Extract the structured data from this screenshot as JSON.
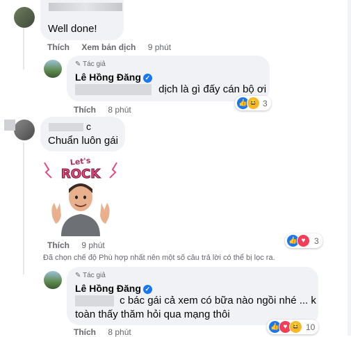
{
  "comments": [
    {
      "author_blurred": true,
      "text": "Well done!",
      "actions": {
        "like": "Thích",
        "translate": "Xem bản dịch",
        "time": "9 phút"
      }
    },
    {
      "author": "Lê Hồng Đăng",
      "role_badge": "Tác giả",
      "text": "dịch là gì đấy cán bộ ơi",
      "reactions": {
        "icons": [
          "like-icon",
          "haha-icon"
        ],
        "count": "3"
      },
      "actions": {
        "like": "Thích",
        "time": "8 phút"
      }
    },
    {
      "author_partial": "c",
      "text": "Chuẩn luôn gái",
      "sticker": {
        "caption": "Let's ROCK"
      },
      "reactions": {
        "icons": [
          "like-icon",
          "love-icon"
        ],
        "count": "3"
      },
      "actions": {
        "like": "Thích",
        "time": "9 phút"
      }
    },
    {
      "author": "Lê Hồng Đăng",
      "role_badge": "Tác giả",
      "text_line1": "c bác gái cả xem có bữa nào ngồi nhé ... k",
      "text_line2": "toàn thấy thăm hỏi qua mạng thôi",
      "reactions": {
        "icons": [
          "like-icon",
          "love-icon",
          "haha-icon"
        ],
        "count": "10"
      },
      "actions": {
        "like": "Thích",
        "time": "8 phút"
      }
    }
  ],
  "filter_notice": "Đã chọn chế độ Phù hợp nhất nên một số câu trả lời có thể bị lọc ra.",
  "colors": {
    "like": "#1877f2",
    "love": "#f33e58",
    "haha": "#f7b928",
    "bubble": "#f0f2f5"
  }
}
